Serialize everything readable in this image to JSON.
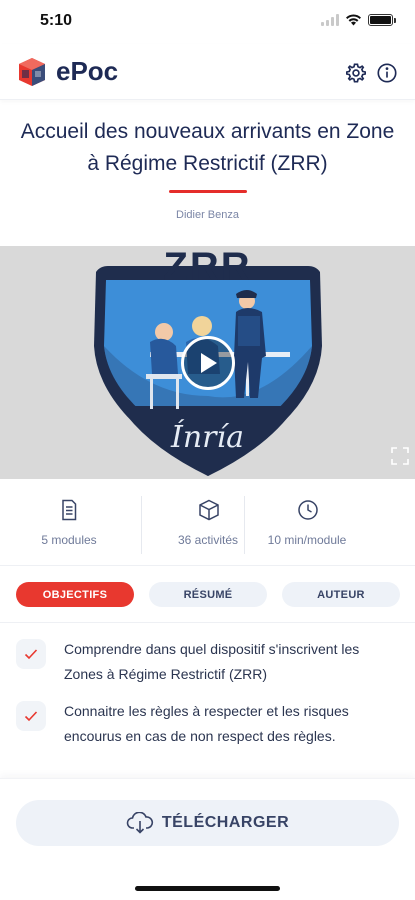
{
  "status_bar": {
    "time": "5:10",
    "icons": [
      "signal-icon",
      "wifi-icon",
      "battery-icon"
    ]
  },
  "header": {
    "app_name": "ePoc",
    "icons": [
      "settings-icon",
      "info-icon"
    ]
  },
  "course": {
    "title": "Accueil des nouveaux arrivants en Zone à Régime Restrictif (ZRR)",
    "author": "Didier Benza"
  },
  "video": {
    "poster_text": "ZRR",
    "brand_text": "Ínría",
    "controls": [
      "play-icon",
      "fullscreen-icon"
    ]
  },
  "stats": [
    {
      "icon": "document-icon",
      "label": "5 modules"
    },
    {
      "icon": "cube-icon",
      "label": "36 activités"
    },
    {
      "icon": "clock-icon",
      "label": "10 min/module"
    }
  ],
  "tabs": [
    {
      "label": "OBJECTIFS",
      "active": true
    },
    {
      "label": "RÉSUMÉ",
      "active": false
    },
    {
      "label": "AUTEUR",
      "active": false
    }
  ],
  "objectives": [
    "Comprendre dans quel dispositif s'inscrivent les Zones à Régime Restrictif (ZRR)",
    "Connaitre les règles à respecter et les risques encourus en cas de non respect des règles."
  ],
  "download": {
    "label": "TÉLÉCHARGER",
    "icon": "cloud-download-icon"
  },
  "colors": {
    "accent": "#e8382f",
    "primary_text": "#1e2a55",
    "button_bg": "#eef2f8",
    "muted_text": "#6f7a99"
  }
}
